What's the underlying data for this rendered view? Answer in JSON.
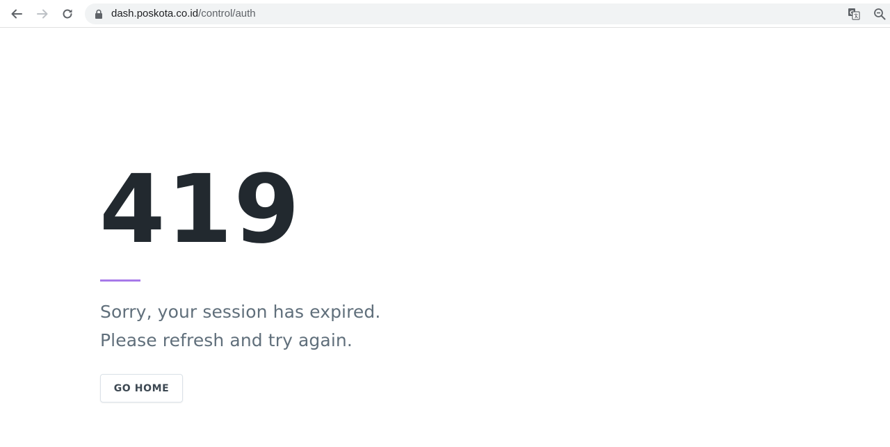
{
  "browser": {
    "address_bar": {
      "host": "dash.poskota.co.id",
      "path": "/control/auth",
      "secure_icon": "lock-icon"
    },
    "icons": {
      "back": "arrow-left-icon",
      "forward": "arrow-right-icon",
      "reload": "reload-icon",
      "translate": "translate-icon",
      "zoom": "zoom-out-icon"
    }
  },
  "page": {
    "error_code": "419",
    "message_line_1": "Sorry, your session has expired.",
    "message_line_2": "Please refresh and try again.",
    "go_home_label": "GO HOME"
  },
  "colors": {
    "error_code": "#22292f",
    "accent_divider": "#a779e9",
    "message_text": "#606f7b",
    "button_border": "#dae1e7"
  }
}
